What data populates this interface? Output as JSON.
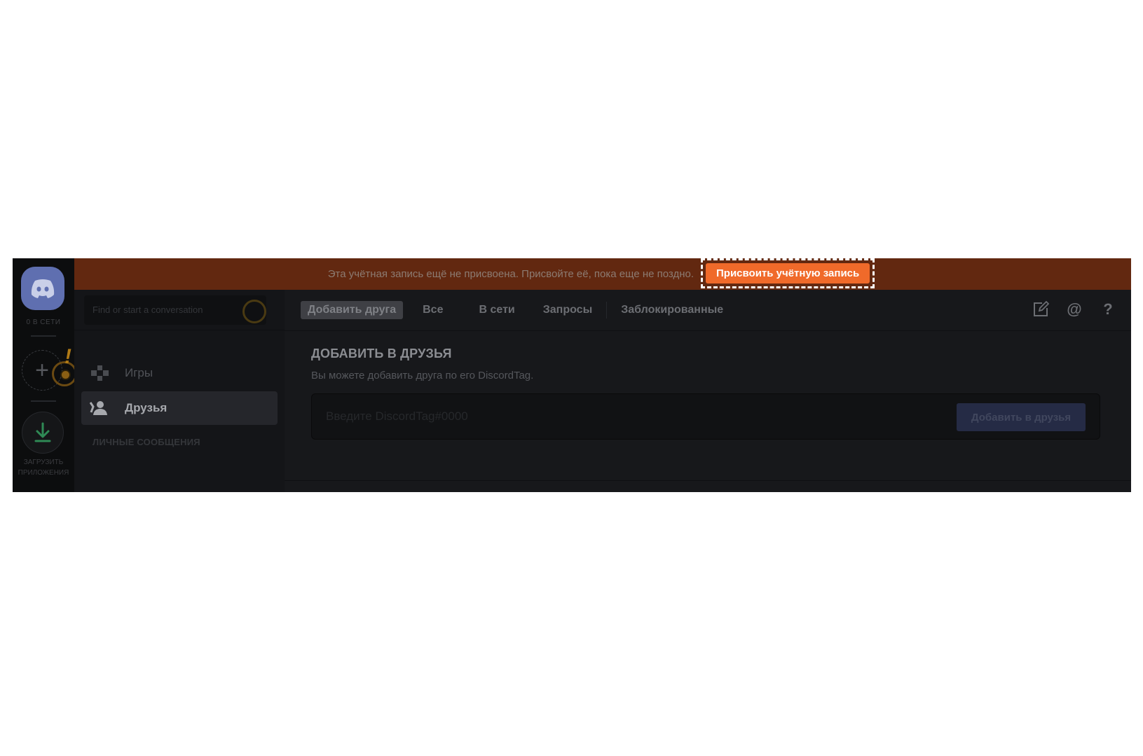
{
  "rail": {
    "online_label": "0 В СЕТИ",
    "add_server_symbol": "+",
    "alert_symbol": "!",
    "download_label_line1": "ЗАГРУЗИТЬ",
    "download_label_line2": "ПРИЛОЖЕНИЯ"
  },
  "banner": {
    "message": "Эта учётная запись ещё не присвоена. Присвойте её, пока еще не поздно.",
    "button_label": "Присвоить учётную запись"
  },
  "dm_sidebar": {
    "search_placeholder": "Find or start a conversation",
    "items": [
      {
        "label": "Игры",
        "icon": "gamepad-icon"
      },
      {
        "label": "Друзья",
        "icon": "friends-icon",
        "selected": true
      }
    ],
    "section_header": "ЛИЧНЫЕ СООБЩЕНИЯ"
  },
  "tabs": {
    "add_friend": "Добавить друга",
    "all": "Все",
    "online": "В сети",
    "requests": "Запросы",
    "blocked": "Заблокированные"
  },
  "top_icons": {
    "mentions_symbol": "@",
    "help_symbol": "?"
  },
  "add_friend": {
    "title": "ДОБАВИТЬ В ДРУЗЬЯ",
    "description": "Вы можете добавить друга по его DiscordTag.",
    "input_placeholder": "Введите DiscordTag#0000",
    "submit_label": "Добавить в друзья"
  },
  "colors": {
    "banner_bg": "#622810",
    "banner_button": "#f06a2a",
    "brand": "#5f6fb0"
  }
}
